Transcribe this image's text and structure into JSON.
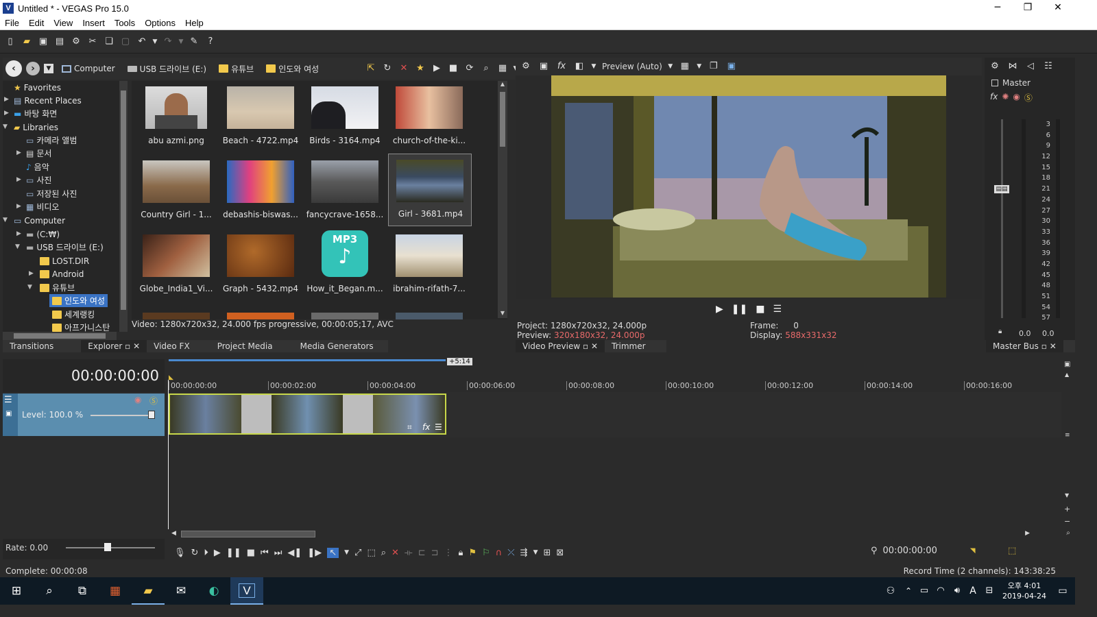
{
  "window": {
    "title": "Untitled * - VEGAS Pro 15.0",
    "app_icon": "V"
  },
  "menu": [
    "File",
    "Edit",
    "View",
    "Insert",
    "Tools",
    "Options",
    "Help"
  ],
  "explorer": {
    "breadcrumb": [
      "Computer",
      "USB 드라이브 (E:)",
      "유튜브",
      "인도와 여성"
    ],
    "tree": [
      {
        "label": "Favorites",
        "indent": 0
      },
      {
        "label": "Recent Places",
        "indent": 0
      },
      {
        "label": "바탕 화면",
        "indent": 0
      },
      {
        "label": "Libraries",
        "indent": 0
      },
      {
        "label": "카메라 앨범",
        "indent": 1
      },
      {
        "label": "문서",
        "indent": 1
      },
      {
        "label": "음악",
        "indent": 1
      },
      {
        "label": "사진",
        "indent": 1
      },
      {
        "label": "저장된 사진",
        "indent": 1
      },
      {
        "label": "비디오",
        "indent": 1
      },
      {
        "label": "Computer",
        "indent": 0
      },
      {
        "label": "(C:₩)",
        "indent": 1
      },
      {
        "label": "USB 드라이브 (E:)",
        "indent": 1
      },
      {
        "label": "LOST.DIR",
        "indent": 2
      },
      {
        "label": "Android",
        "indent": 2
      },
      {
        "label": "유튜브",
        "indent": 2
      },
      {
        "label": "인도와 여성",
        "indent": 3
      },
      {
        "label": "세계랭킹",
        "indent": 3
      },
      {
        "label": "아프가니스탄",
        "indent": 3
      }
    ],
    "files": [
      {
        "name": "abu azmi.png"
      },
      {
        "name": "Beach - 4722.mp4"
      },
      {
        "name": "Birds - 3164.mp4"
      },
      {
        "name": "church-of-the-ki..."
      },
      {
        "name": "Country Girl - 1..."
      },
      {
        "name": "debashis-biswas..."
      },
      {
        "name": "fancycrave-1658..."
      },
      {
        "name": "Girl - 3681.mp4"
      },
      {
        "name": "Globe_India1_Vi..."
      },
      {
        "name": "Graph - 5432.mp4"
      },
      {
        "name": "How_it_Began.m..."
      },
      {
        "name": "ibrahim-rifath-7..."
      }
    ],
    "mp3_badge": "MP3",
    "status": "Video: 1280x720x32, 24.000 fps progressive, 00:00:05;17, AVC"
  },
  "left_tabs": [
    "Transitions",
    "Explorer",
    "Video FX",
    "Project Media",
    "Media Generators"
  ],
  "preview": {
    "mode_label": "Preview (Auto)",
    "project_label": "Project:",
    "project_value": "1280x720x32, 24.000p",
    "preview_label": "Preview:",
    "preview_value": "320x180x32, 24.000p",
    "frame_label": "Frame:",
    "frame_value": "0",
    "display_label": "Display:",
    "display_value": "588x331x32",
    "tabs": [
      "Video Preview",
      "Trimmer"
    ]
  },
  "master": {
    "title": "Master",
    "scale": [
      "3",
      "6",
      "9",
      "12",
      "15",
      "18",
      "21",
      "24",
      "27",
      "30",
      "33",
      "36",
      "39",
      "42",
      "45",
      "48",
      "51",
      "54",
      "57"
    ],
    "left_val": "0.0",
    "right_val": "0.0",
    "tab": "Master Bus"
  },
  "timeline": {
    "time": "00:00:00:00",
    "loop_label": "+5:14",
    "ruler": [
      "00:00:00:00",
      "00:00:02:00",
      "00:00:04:00",
      "00:00:06:00",
      "00:00:08:00",
      "00:00:10:00",
      "00:00:12:00",
      "00:00:14:00",
      "00:00:16:00"
    ],
    "track_level": "Level: 100.0 %",
    "rate": "Rate: 0.00",
    "cursor_time": "00:00:00:00"
  },
  "status": {
    "left": "Complete: 00:00:08",
    "right": "Record Time (2 channels): 143:38:25"
  },
  "taskbar": {
    "time": "오후 4:01",
    "date": "2019-04-24",
    "ime": "A"
  }
}
